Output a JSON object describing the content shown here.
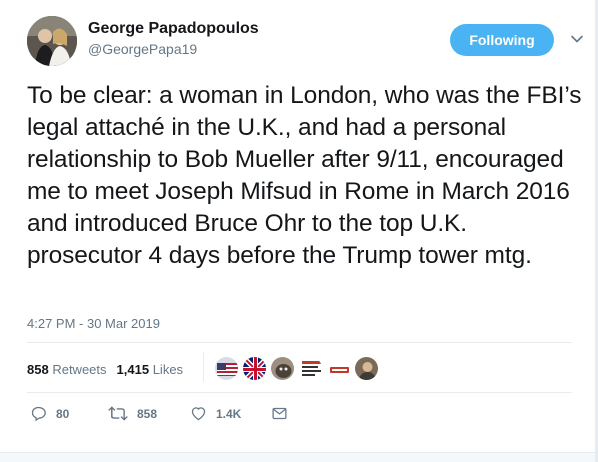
{
  "author": {
    "name": "George Papadopoulos",
    "handle": "@GeorgePapa19"
  },
  "follow_button": {
    "label": "Following",
    "color": "#4ab3f4"
  },
  "tweet": {
    "text": "To be clear: a woman in London, who was the FBI’s legal attaché in the U.K., and had a personal relationship to Bob Mueller after 9/11, encouraged me to meet Joseph Mifsud in Rome in March 2016 and introduced Bruce Ohr to the top U.K. prosecutor 4 days before the Trump tower mtg.",
    "timestamp": "4:27 PM - 30 Mar 2019"
  },
  "stats": {
    "retweets_count": "858",
    "retweets_label": "Retweets",
    "likes_count": "1,415",
    "likes_label": "Likes"
  },
  "liker_avatars": [
    {
      "icon": "flag-avatar-1"
    },
    {
      "icon": "flag-avatar-2"
    },
    {
      "icon": "animal-avatar"
    },
    {
      "icon": "text-logo-avatar"
    },
    {
      "icon": "wto-logo-avatar"
    },
    {
      "icon": "person-avatar"
    }
  ],
  "actions": {
    "reply_count": "80",
    "retweet_count": "858",
    "like_count": "1.4K"
  },
  "colors": {
    "text": "#14171a",
    "secondary": "#657786",
    "divider": "#e6ecf0",
    "accent": "#4ab3f4"
  }
}
